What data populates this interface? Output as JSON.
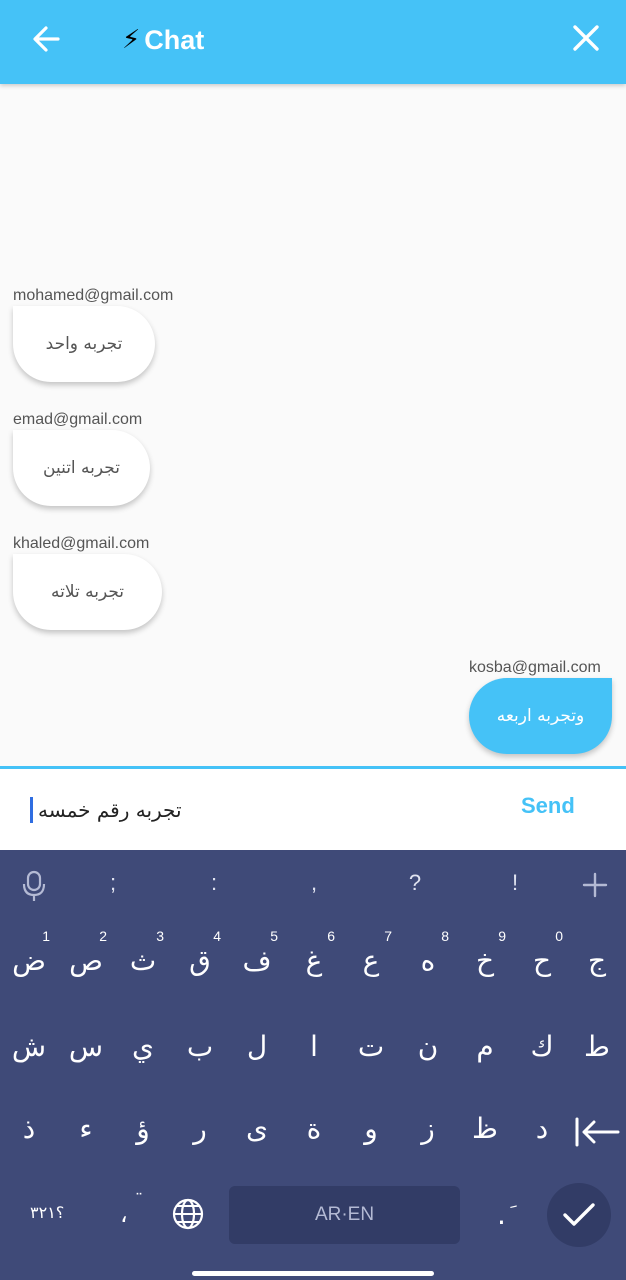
{
  "app_bar": {
    "title_icon": "⚡",
    "title": "Chat",
    "back_icon": "arrow-left-icon",
    "close_icon": "close-icon",
    "background": "#45c2f7"
  },
  "messages": [
    {
      "sender": "mohamed@gmail.com",
      "text": "تجربه واحد",
      "direction": "incoming"
    },
    {
      "sender": "emad@gmail.com",
      "text": "تجربه اتنين",
      "direction": "incoming"
    },
    {
      "sender": "khaled@gmail.com",
      "text": "تجربه تلاته",
      "direction": "incoming"
    },
    {
      "sender": "kosba@gmail.com",
      "text": "وتجربه اربعه",
      "direction": "outgoing"
    }
  ],
  "composer": {
    "value": "تجربه رقم خمسه",
    "send_label": "Send",
    "accent": "#45c2f7"
  },
  "keyboard": {
    "symbols": [
      ";",
      ":",
      ",",
      "?",
      "!"
    ],
    "row1": [
      {
        "ch": "ض",
        "n": "1"
      },
      {
        "ch": "ص",
        "n": "2"
      },
      {
        "ch": "ث",
        "n": "3"
      },
      {
        "ch": "ق",
        "n": "4"
      },
      {
        "ch": "ف",
        "n": "5"
      },
      {
        "ch": "غ",
        "n": "6"
      },
      {
        "ch": "ع",
        "n": "7"
      },
      {
        "ch": "ه",
        "n": "8"
      },
      {
        "ch": "خ",
        "n": "9"
      },
      {
        "ch": "ح",
        "n": "0"
      },
      {
        "ch": "ج",
        "n": ""
      }
    ],
    "row2": [
      "ش",
      "س",
      "ي",
      "ب",
      "ل",
      "ا",
      "ت",
      "ن",
      "م",
      "ك",
      "ط"
    ],
    "row3": [
      "ذ",
      "ء",
      "ؤ",
      "ر",
      "ى",
      "ة",
      "و",
      "ز",
      "ظ",
      "د"
    ],
    "bottom": {
      "numbers_key": "؟٣٢١",
      "comma_key": "،",
      "comma_hint": "¨",
      "space_label": "AR·EN",
      "period_key": ".",
      "period_hint": "ِ"
    },
    "background": "#3f4a78"
  }
}
